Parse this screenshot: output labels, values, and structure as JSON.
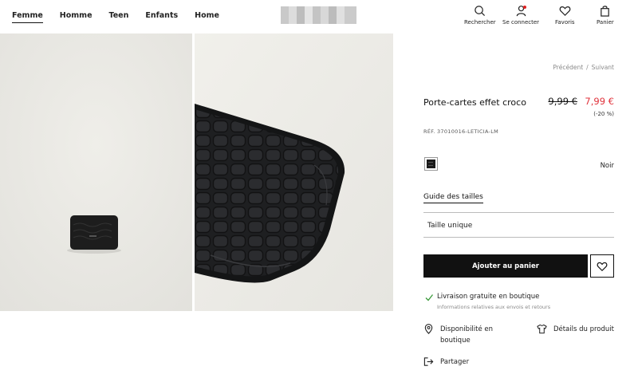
{
  "header": {
    "nav": [
      {
        "label": "Femme",
        "active": true
      },
      {
        "label": "Homme",
        "active": false
      },
      {
        "label": "Teen",
        "active": false
      },
      {
        "label": "Enfants",
        "active": false
      },
      {
        "label": "Home",
        "active": false
      }
    ],
    "logo_note": "blurred-logo",
    "actions": {
      "search": {
        "label": "Rechercher",
        "icon": "search-icon"
      },
      "account": {
        "label": "Se connecter",
        "icon": "user-icon"
      },
      "favorites": {
        "label": "Favoris",
        "icon": "heart-icon"
      },
      "cart": {
        "label": "Panier",
        "icon": "shopping-bag-icon"
      }
    }
  },
  "gallery": {
    "images": [
      "product-thumbnail",
      "product-closeup"
    ]
  },
  "product": {
    "prev_label": "Précédent",
    "separator": "/",
    "next_label": "Suivant",
    "title": "Porte-cartes effet croco",
    "old_price": "9,99 €",
    "new_price": "7,99 €",
    "discount": "(-20 %)",
    "ref": "RÉF. 37010016-LETICIA-LM",
    "color": {
      "name": "Noir",
      "swatch": "#1a1a1a"
    },
    "size_guide_label": "Guide des tailles",
    "size_value": "Taille unique",
    "add_to_cart_label": "Ajouter au panier",
    "delivery_title": "Livraison gratuite en boutique",
    "delivery_sub": "Informations relatives aux envois et retours",
    "availability_label": "Disponibilité en boutique",
    "details_label": "Détails du produit",
    "share_label": "Partager"
  },
  "colors": {
    "sale_red": "#e0323b",
    "button_black": "#111111",
    "check_green": "#3a9a3a"
  }
}
